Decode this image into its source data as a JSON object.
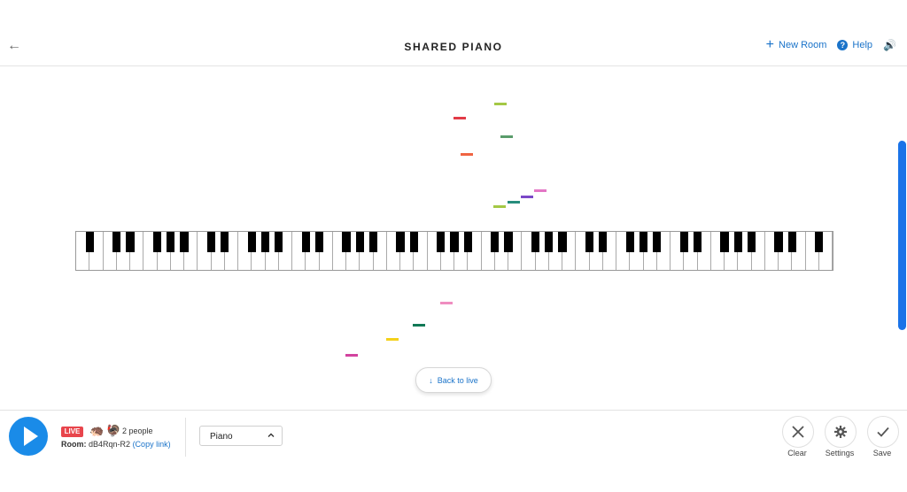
{
  "header": {
    "title": "SHARED PIANO",
    "new_room_label": "New Room",
    "help_label": "Help"
  },
  "roll": {
    "colors": {
      "lime": "#a4c845",
      "red": "#e23b47",
      "green": "#5a9c6b",
      "orange": "#f06442",
      "teal": "#278d7d",
      "purple": "#7b48c8",
      "pink": "#e376c5",
      "lightpink": "#ef8dc0",
      "darkgreen": "#117956",
      "yellow": "#f4d11b",
      "magenta": "#d2439f"
    }
  },
  "back_to_live": "Back to live",
  "footer": {
    "live_badge": "LIVE",
    "people_label": "2 people",
    "room_label": "Room:",
    "room_id": "dB4Rqn-R2",
    "copy_link": "(Copy link)",
    "instrument": "Piano",
    "tools": [
      {
        "label": "Clear",
        "icon": "close-icon"
      },
      {
        "label": "Settings",
        "icon": "gear-icon"
      },
      {
        "label": "Save",
        "icon": "check-icon"
      }
    ]
  }
}
